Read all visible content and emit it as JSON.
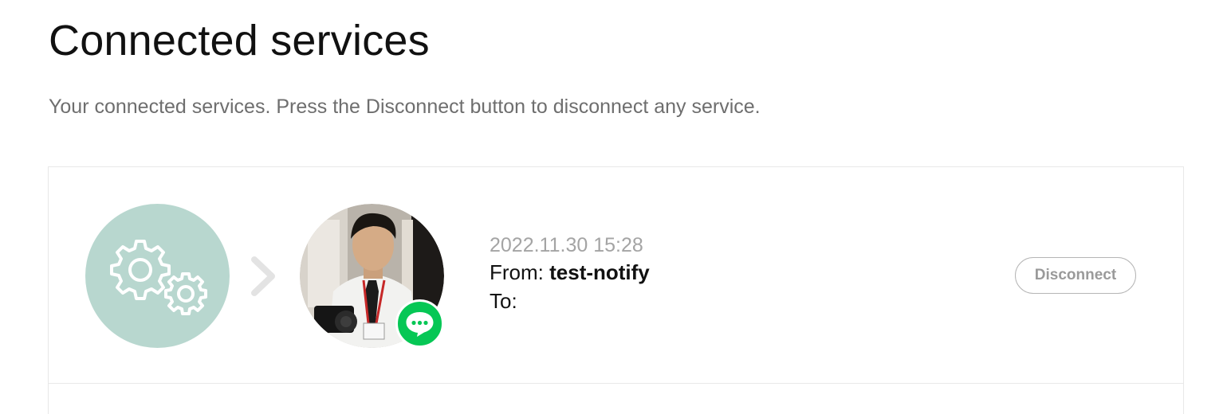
{
  "header": {
    "title": "Connected services",
    "description": "Your connected services. Press the Disconnect button to disconnect any service."
  },
  "services": [
    {
      "service_icon": "gears-icon",
      "arrow_icon": "chevron-right-icon",
      "avatar": "user-avatar-photo",
      "badge_icon": "chat-bubble-icon",
      "date": "2022.11.30 15:28",
      "from_label": "From: ",
      "from_name": "test-notify",
      "to_label": "To:",
      "disconnect_label": "Disconnect"
    }
  ],
  "colors": {
    "service_icon_bg": "#b8d7cf",
    "badge_bg": "#06c755",
    "muted_text": "#6e6e6e",
    "date_text": "#a4a4a4",
    "button_border": "#b5b5b5"
  }
}
